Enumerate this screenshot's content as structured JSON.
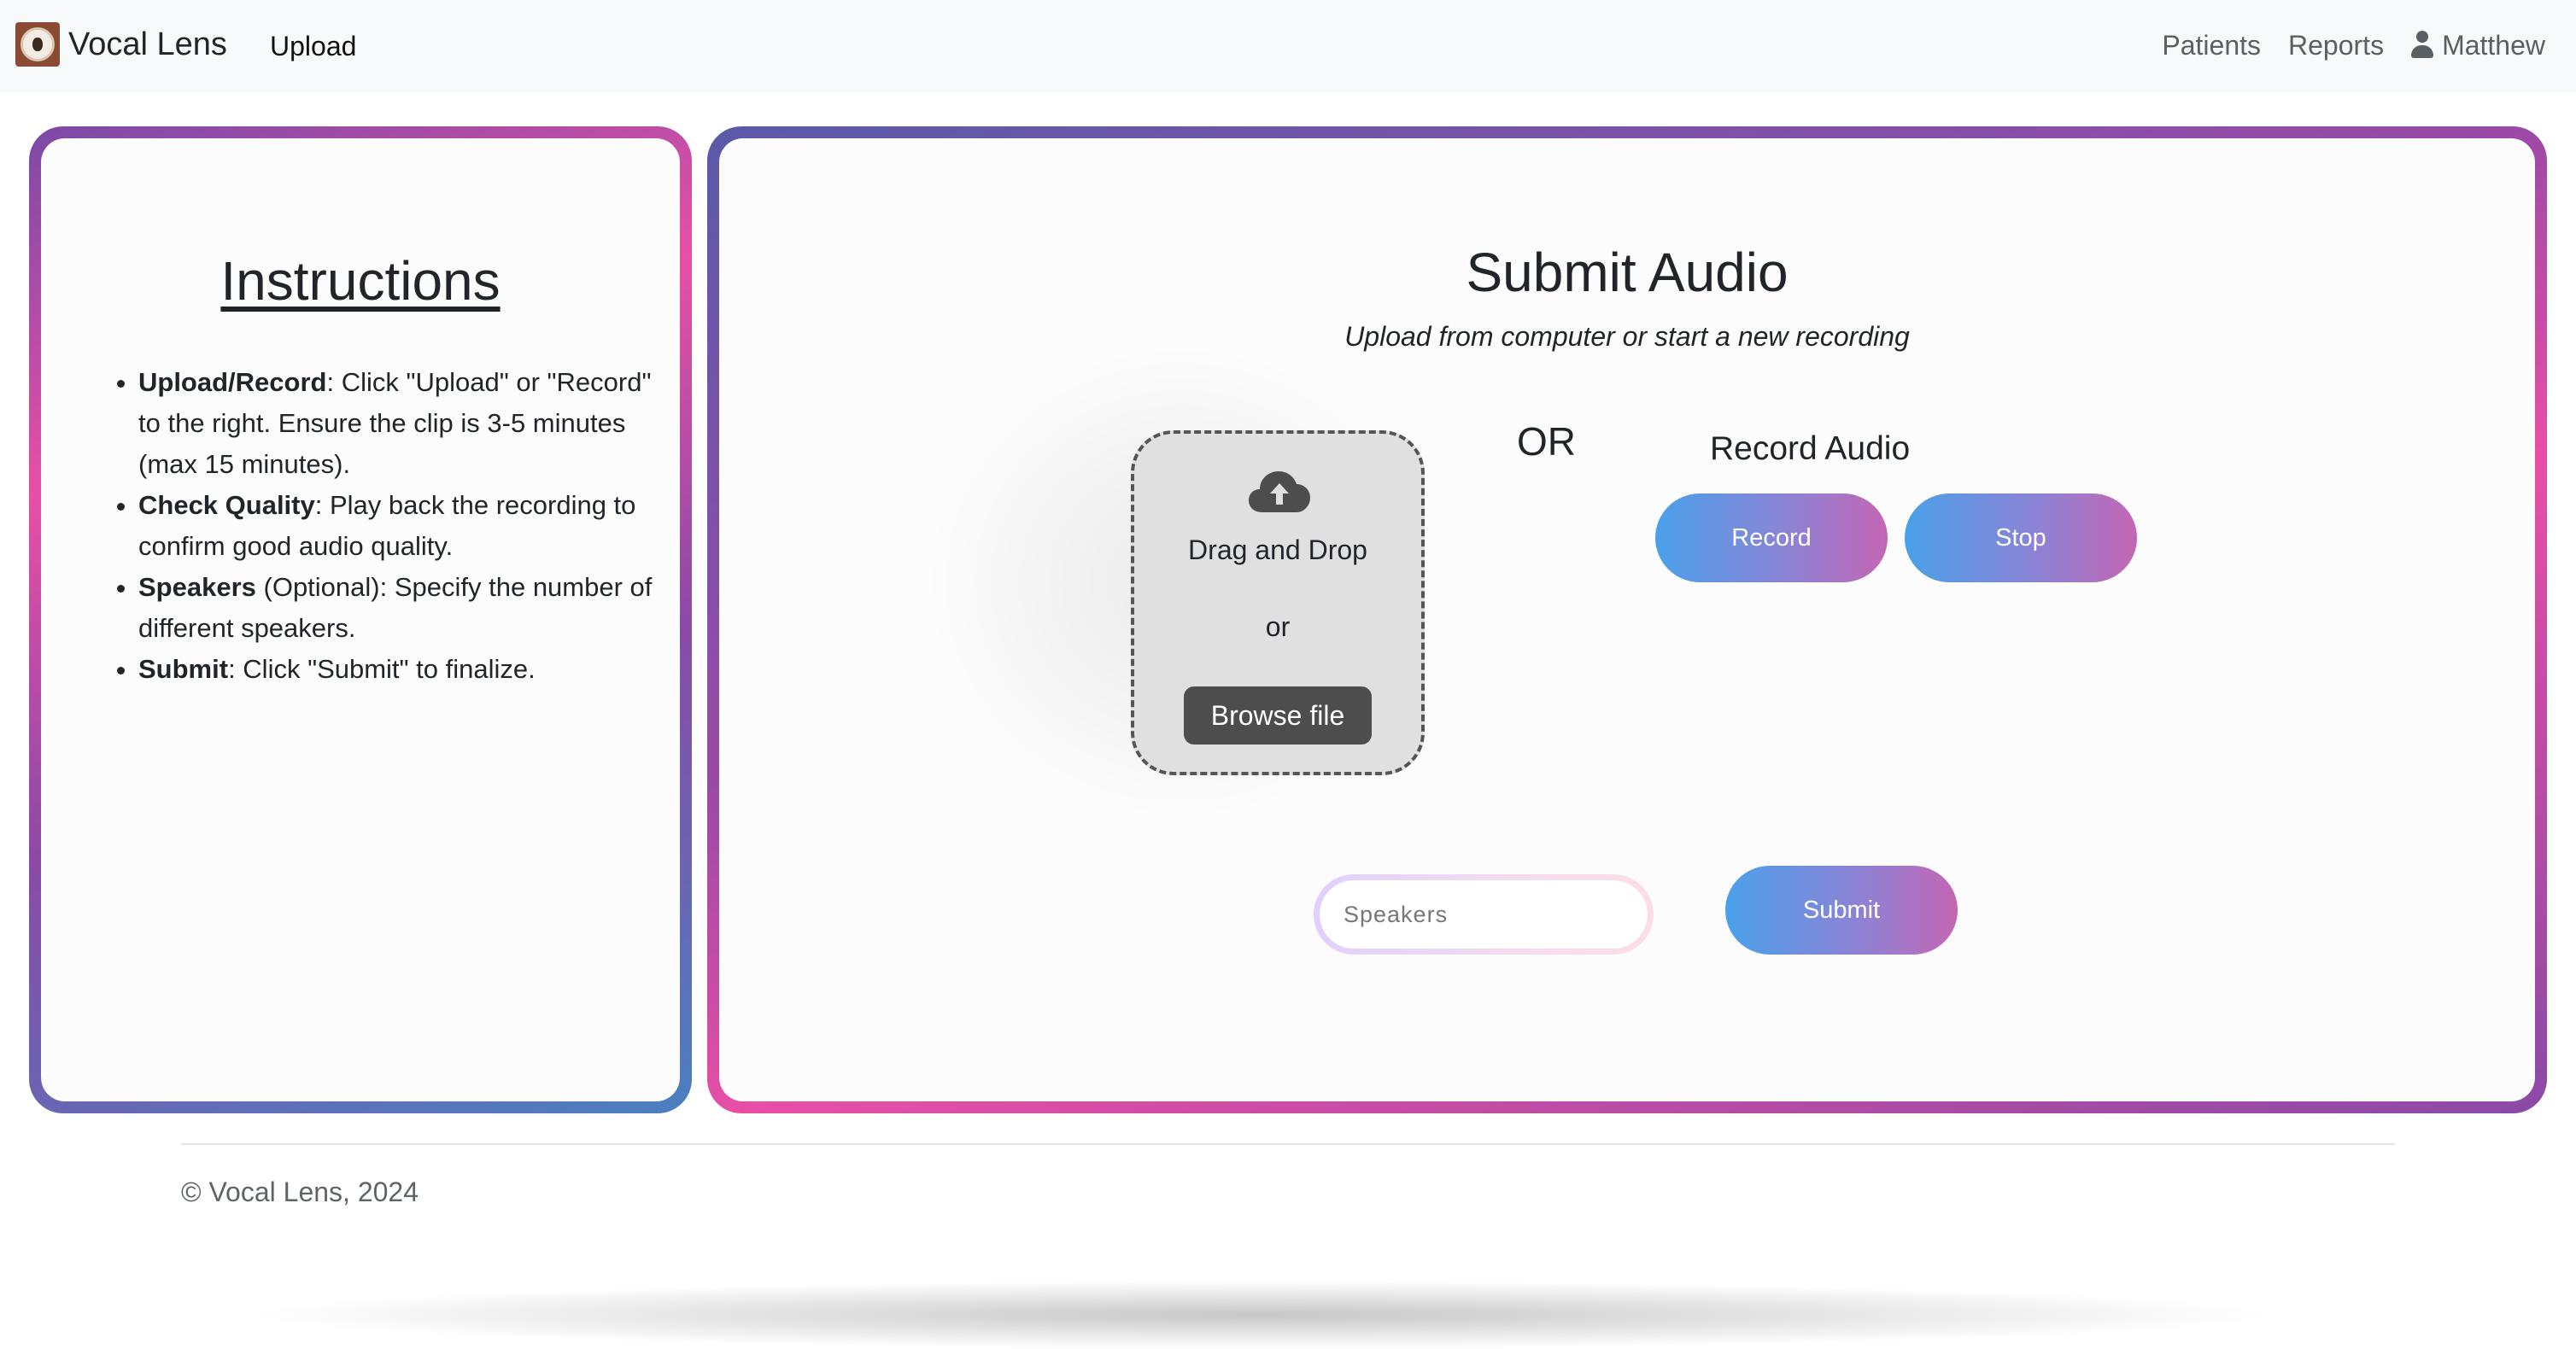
{
  "navbar": {
    "brand": "Vocal Lens",
    "upload_link": "Upload",
    "patients_link": "Patients",
    "reports_link": "Reports",
    "user_name": "Matthew"
  },
  "instructions": {
    "title": "Instructions",
    "items": [
      {
        "bold": "Upload/Record",
        "text": ": Click \"Upload\" or \"Record\" to the right. Ensure the clip is 3-5 minutes (max 15 minutes)."
      },
      {
        "bold": "Check Quality",
        "text": ": Play back the recording to confirm good audio quality."
      },
      {
        "bold": "Speakers",
        "text": " (Optional): Specify the number of different speakers."
      },
      {
        "bold": "Submit",
        "text": ": Click \"Submit\" to finalize."
      }
    ]
  },
  "submit_audio": {
    "title": "Submit Audio",
    "subtitle": "Upload from computer or start a new recording",
    "dropzone": {
      "icon": "cloud-upload-icon",
      "drag_text": "Drag and Drop",
      "or_text": "or",
      "browse_label": "Browse file"
    },
    "or_divider": "OR",
    "record": {
      "title": "Record Audio",
      "record_label": "Record",
      "stop_label": "Stop"
    },
    "speakers_placeholder": "Speakers",
    "submit_label": "Submit"
  },
  "footer": {
    "copyright": "© Vocal Lens, 2024"
  },
  "colors": {
    "gradient_blue": "#4aa0ea",
    "gradient_purple": "#8a4aa6",
    "gradient_pink": "#e84ea6",
    "navbar_bg": "#f8f9fa",
    "browse_button": "#4d4d4d"
  }
}
